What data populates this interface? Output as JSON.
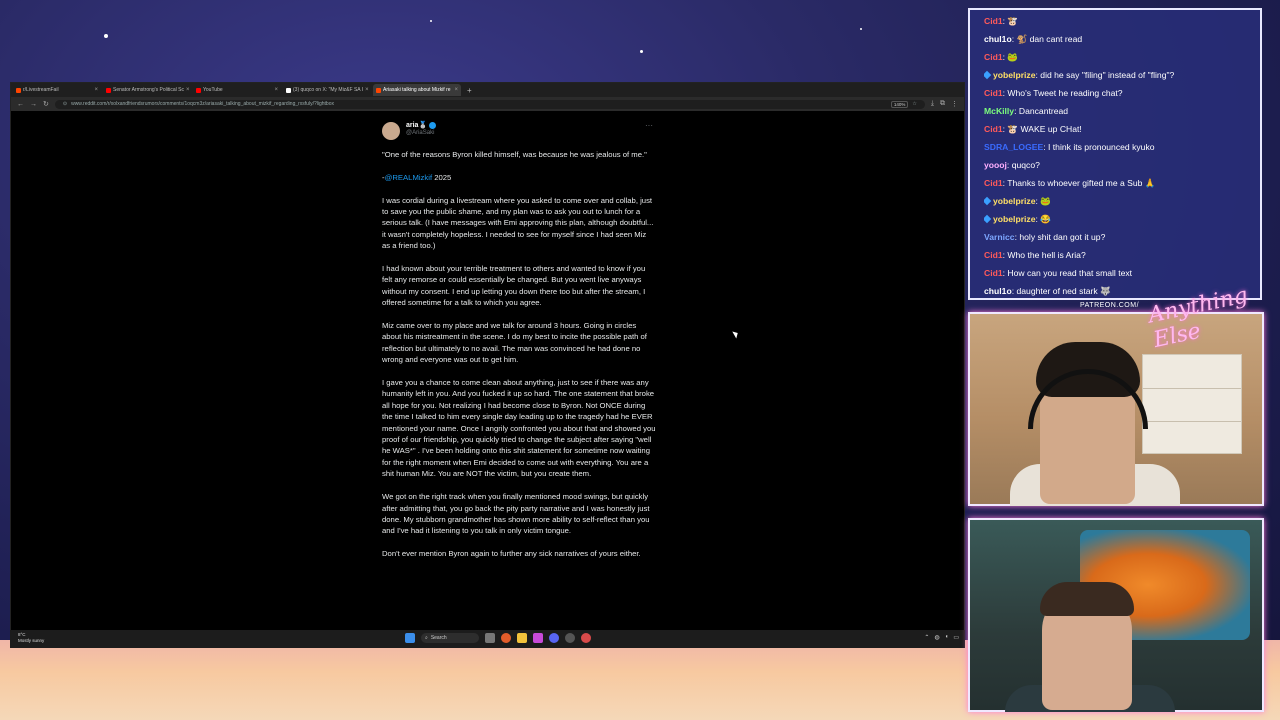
{
  "browser": {
    "tabs": [
      {
        "label": "r/LivestreamFail",
        "color": "#ff4500"
      },
      {
        "label": "Senator Armstrong's Political Sc",
        "color": "#ff0000"
      },
      {
        "label": "YouTube",
        "color": "#ff0000"
      },
      {
        "label": "(3) quqco on X: \"My Miz&F SA I",
        "color": "#ffffff"
      },
      {
        "label": "Ariasaki talking about Mizkif re",
        "color": "#ff4500"
      }
    ],
    "url": "www.reddit.com/r/xolxandfriendsrumors/comments/1oqcm3z/ariasaki_talking_about_mizkif_regarding_rxsfuly/?lightbox",
    "zoom": "140%"
  },
  "tweet": {
    "name": "aria🥈",
    "handle": "@AriaSaki",
    "paragraphs": [
      "\"One of the reasons Byron killed himself, was because he was jealous of me.\"",
      "I was cordial during a livestream where you asked to come over and collab, just to save you the public shame, and my plan was to ask you out to lunch for a serious talk. (I have messages with Emi approving this plan, although doubtful... it wasn't completely hopeless. I needed to see for myself since I had seen Miz as a friend too.)",
      "I had known about your terrible treatment to others and wanted to know if you felt any remorse or could essentially be changed. But you went live anyways without my consent. I end up letting you down there too but after the stream, I offered sometime for a talk to which you agree.",
      "Miz came over to my place and we talk for around 3 hours. Going in circles about his mistreatment in the scene. I do my best to incite the possible path of reflection but ultimately to no avail. The man was convinced he had done no wrong and everyone was out to get him.",
      "I gave you a chance to come clean about anything, just to see if there was any humanity left in you. And you fucked it up so hard. The one statement that broke all hope for you. Not realizing I had become close to Byron. Not ONCE during the time I talked to him every single day leading up to the tragedy had he EVER mentioned your name. Once I angrily confronted you about that and showed you proof of our friendship, you quickly tried to change the subject after saying \"well he WAS*\" . I've been holding onto this shit statement for sometime now waiting for the right moment when Emi decided to come out with everything. You are a shit human Miz. You are NOT the victim, but you create them.",
      "We got on the right track when you finally mentioned mood swings, but quickly after admitting that, you go back the pity party narrative and I was honestly just done. My stubborn grandmother has shown more ability to self-reflect than you and I've had it listening to you talk in only victim tongue.",
      "Don't ever mention Byron again to further any sick narratives of yours either."
    ],
    "attribution_prefix": "-",
    "attribution_mention": "@REALMizkif",
    "attribution_suffix": " 2025"
  },
  "taskbar": {
    "temp": "8°C",
    "weather": "Mostly sunny",
    "search": "Search"
  },
  "chat": [
    {
      "user": "Cid1",
      "color": "#ff5a5a",
      "text": "🐮",
      "badge": false
    },
    {
      "user": "chul1o",
      "color": "#ffffff",
      "text": "🐒 dan cant read",
      "badge": false
    },
    {
      "user": "Cid1",
      "color": "#ff5a5a",
      "text": "🐸",
      "badge": false
    },
    {
      "user": "yobelprize",
      "color": "#ffe066",
      "text": "did he say \"filing\" instead of \"fling\"?",
      "badge": true
    },
    {
      "user": "Cid1",
      "color": "#ff5a5a",
      "text": "Who's Tweet he reading chat?",
      "badge": false
    },
    {
      "user": "McKilly",
      "color": "#7dff7d",
      "text": "Dancantread",
      "badge": false
    },
    {
      "user": "Cid1",
      "color": "#ff5a5a",
      "text": "🐮 WAKE up CHat!",
      "badge": false
    },
    {
      "user": "SDRA_LOGEE",
      "color": "#3a6bff",
      "text": "I think its pronounced kyuko",
      "badge": false
    },
    {
      "user": "yoooj",
      "color": "#ffb0ff",
      "text": "quqco?",
      "badge": false
    },
    {
      "user": "Cid1",
      "color": "#ff5a5a",
      "text": "Thanks to whoever gifted me a Sub 🙏",
      "badge": false
    },
    {
      "user": "yobelprize",
      "color": "#ffe066",
      "text": "🐸",
      "badge": true
    },
    {
      "user": "yobelprize",
      "color": "#ffe066",
      "text": "😂",
      "badge": true
    },
    {
      "user": "Varnicc",
      "color": "#7da7ff",
      "text": "holy shit dan got it up?",
      "badge": false
    },
    {
      "user": "Cid1",
      "color": "#ff5a5a",
      "text": "Who the hell is Aria?",
      "badge": false
    },
    {
      "user": "Cid1",
      "color": "#ff5a5a",
      "text": "How can you read that small text",
      "badge": false
    },
    {
      "user": "chul1o",
      "color": "#ffffff",
      "text": "daughter of ned stark 🐺",
      "badge": false
    }
  ],
  "overlay": {
    "patreon": "PATREON.COM/",
    "script_logo": "Anything Else"
  }
}
